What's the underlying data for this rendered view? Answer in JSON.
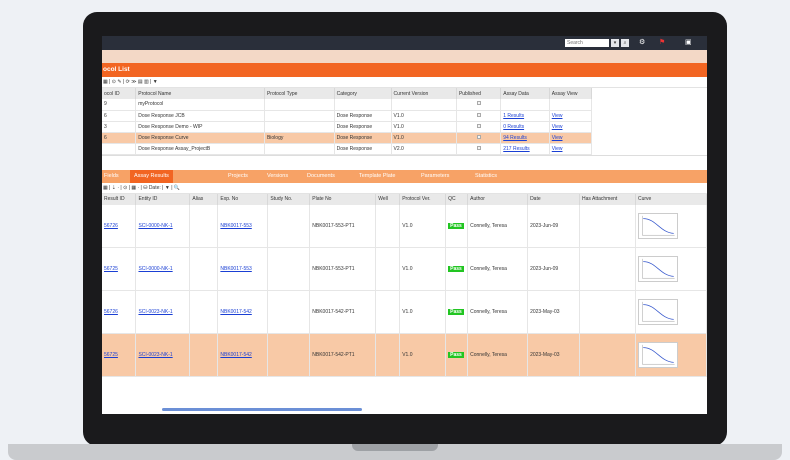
{
  "topbar": {
    "search_placeholder": "Search"
  },
  "protocol_list": {
    "title": "ocol List",
    "toolbar_text": "▦ | ⊙ ✎ | ⟳ ≫ ▤ ▥ | ▼",
    "columns": [
      "ocol ID",
      "Protocol Name",
      "Protocol Type",
      "Category",
      "Current Version",
      "Published",
      "Assay Data",
      "Assay View"
    ],
    "rows": [
      {
        "id": "9",
        "name": "myProtocol",
        "type": "",
        "category": "",
        "version": "",
        "assay_data": "",
        "view": ""
      },
      {
        "id": "6",
        "name": "Dose Response JCB",
        "type": "",
        "category": "Dose Response",
        "version": "V1.0",
        "assay_data": "1 Results",
        "view": "View"
      },
      {
        "id": "3",
        "name": "Dose Response Demo - WIP",
        "type": "",
        "category": "Dose Response",
        "version": "V1.0",
        "assay_data": "0 Results",
        "view": "View"
      },
      {
        "id": "6",
        "name": "Dose Response Curve",
        "type": "Biology",
        "category": "Dose Response",
        "version": "V1.0",
        "assay_data": "94 Results",
        "view": "View"
      },
      {
        "id": "",
        "name": "Dose Response Assay_ProjectB",
        "type": "",
        "category": "Dose Response",
        "version": "V2.0",
        "assay_data": "217 Results",
        "view": "View"
      }
    ]
  },
  "tabs": [
    "Fields",
    "Assay Results",
    "Projects",
    "Versions",
    "Documents",
    "Template Plate",
    "Parameters",
    "Statistics"
  ],
  "results_toolbar_text": "▦ | ⇣ · | ⊙ | ▦ · | ⛁ Date:          | ▼ | 🔍",
  "results": {
    "columns": [
      "Result ID",
      "Entity ID",
      "Alias",
      "Exp. No",
      "Study No.",
      "Plate No",
      "Well",
      "Protocol Ver.",
      "QC",
      "Author",
      "Date",
      "Has Attachment",
      "Curve"
    ],
    "rows": [
      {
        "id": "56726",
        "entity": "SCI-0000-NK-1",
        "exp": "NBK0017-553",
        "plate": "NBK0017-553-PT1",
        "ver": "V1.0",
        "qc": "Pass",
        "author": "Connelly, Teresa",
        "date": "2023-Jun-09"
      },
      {
        "id": "56725",
        "entity": "SCI-0000-NK-1",
        "exp": "NBK0017-553",
        "plate": "NBK0017-553-PT1",
        "ver": "V1.0",
        "qc": "Pass",
        "author": "Connelly, Teresa",
        "date": "2023-Jun-09"
      },
      {
        "id": "56726",
        "entity": "SCI-0023-NK-1",
        "exp": "NBK0017-542",
        "plate": "NBK0017-542-PT1",
        "ver": "V1.0",
        "qc": "Pass",
        "author": "Connelly, Teresa",
        "date": "2023-May-03"
      },
      {
        "id": "56725",
        "entity": "SCI-0023-NK-1",
        "exp": "NBK0017-542",
        "plate": "NBK0017-542-PT1",
        "ver": "V1.0",
        "qc": "Pass",
        "author": "Connelly, Teresa",
        "date": "2023-May-03"
      }
    ]
  },
  "colors": {
    "accent": "#f26522",
    "highlight": "#f8c9a6",
    "pass": "#22c522"
  }
}
